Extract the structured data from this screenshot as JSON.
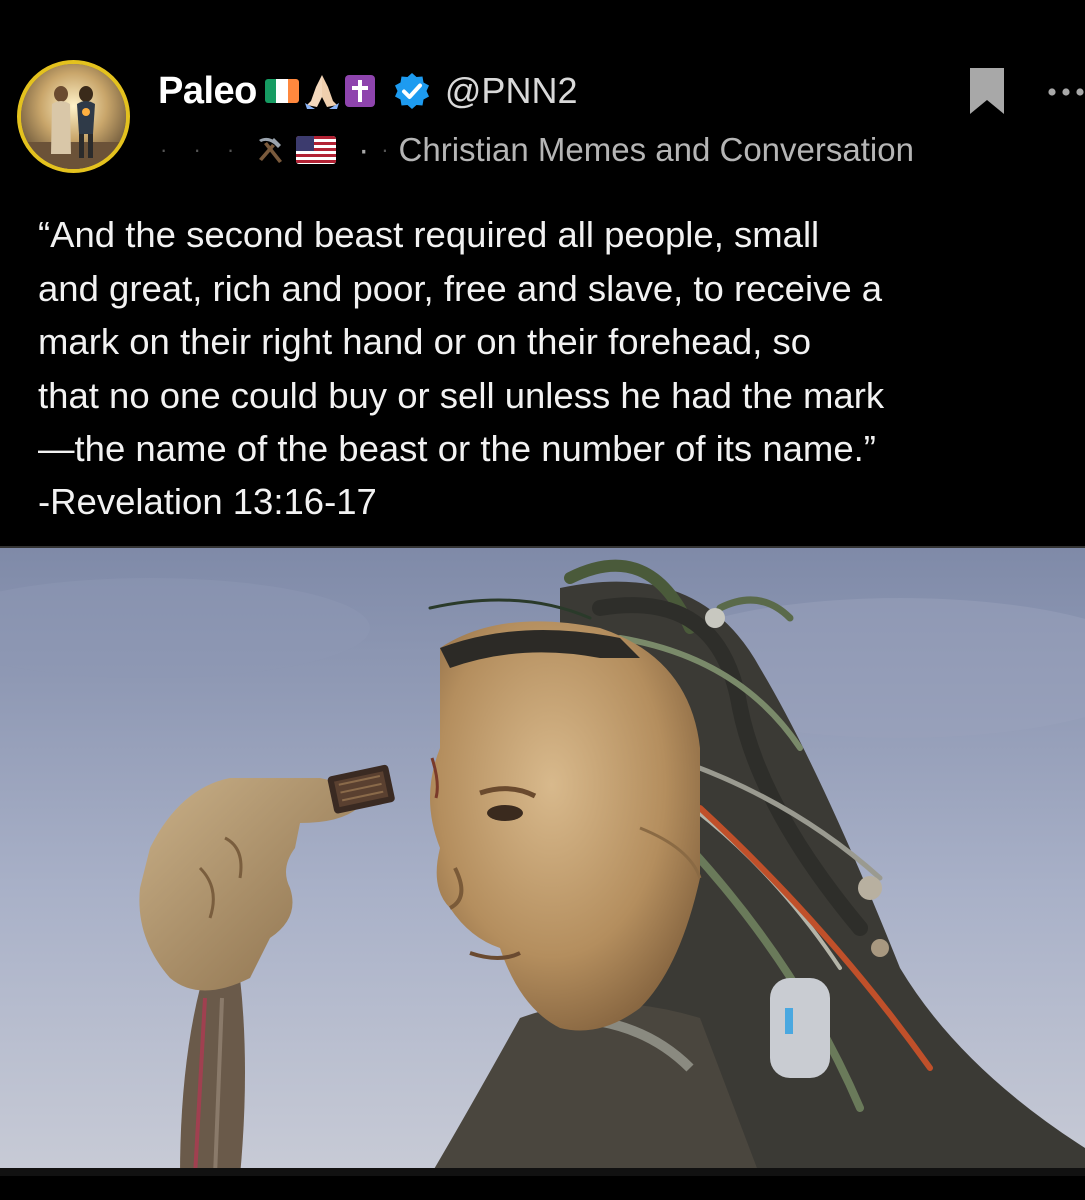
{
  "post": {
    "author": {
      "display_name": "Paleo",
      "handle": "@PNN2",
      "verified": true,
      "name_emojis": [
        "ireland-flag-icon",
        "praying-hands-icon",
        "latin-cross-icon"
      ],
      "sub_icons": [
        "hammer-and-pick-icon",
        "us-flag-icon"
      ],
      "community": "Christian Memes and Conversation"
    },
    "body": "“And the second beast required all people, small\nand great, rich and poor, free and slave, to receive a\nmark on their right hand or on their forehead, so\nthat no one could buy or sell unless he had the mark\n—the name of the beast or the number of its name.”",
    "citation": "-Revelation 13:16-17",
    "media": {
      "description_icon": "cyborg-head-with-microchip-image"
    }
  },
  "colors": {
    "background": "#000000",
    "verified": "#1d9bf0",
    "avatar_ring": "#e4c21e",
    "text": "#f2f2f2",
    "secondary_text": "#a8a8a8"
  }
}
